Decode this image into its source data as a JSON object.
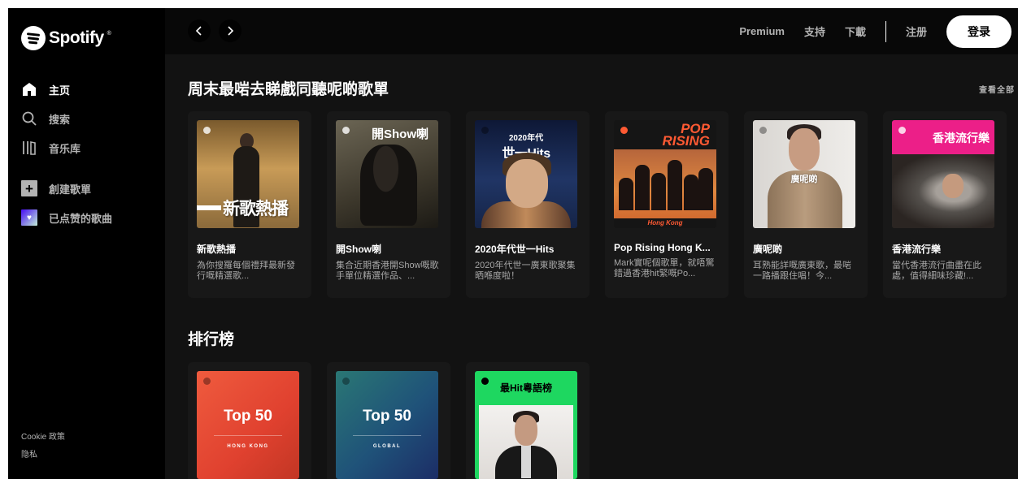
{
  "brand": {
    "name": "Spotify"
  },
  "sidebar": {
    "nav": [
      {
        "label": "主页",
        "icon": "home-icon"
      },
      {
        "label": "搜索",
        "icon": "search-icon"
      },
      {
        "label": "音乐库",
        "icon": "library-icon"
      }
    ],
    "actions": [
      {
        "label": "創建歌單",
        "icon": "plus-icon"
      },
      {
        "label": "已点赞的歌曲",
        "icon": "heart-icon"
      }
    ],
    "legal": {
      "cookie": "Cookie 政策",
      "privacy": "隐私"
    }
  },
  "topbar": {
    "premium": "Premium",
    "support": "支持",
    "download": "下載",
    "signup": "注册",
    "login": "登录"
  },
  "section1": {
    "title": "周末最啱去睇戲同聽呢啲歌單",
    "see_all": "查看全部",
    "cards": [
      {
        "title": "新歌熱播",
        "desc": "為你搜羅每個禮拜最新發行嘅精選歌...",
        "cover_text": "新歌熱播"
      },
      {
        "title": "開Show喇",
        "desc": "集合近期香港開Show嘅歌手單位精選作品、...",
        "cover_text": "開Show喇"
      },
      {
        "title": "2020年代世一Hits",
        "desc": "2020年代世一廣東歌聚集晒喺度啦！",
        "cover_text_1": "2020年代",
        "cover_text_2": "世一Hits"
      },
      {
        "title": "Pop Rising Hong K...",
        "desc": "Mark實呢個歌單，就唔驚錯過香港hit緊嘅Po...",
        "cover_text_1": "POP",
        "cover_text_2": "RISING",
        "cover_text_3": "Hong Kong"
      },
      {
        "title": "廣呢啲",
        "desc": "耳熟能詳嘅廣東歌，最啱一路播跟住唱！今...",
        "cover_text": "廣呢啲"
      },
      {
        "title": "香港流行樂",
        "desc": "當代香港流行曲盡在此處，值得細味珍藏!...",
        "cover_text": "香港流行樂"
      }
    ]
  },
  "section2": {
    "title": "排行榜",
    "cards": [
      {
        "cover_big": "Top 50",
        "cover_small": "HONG KONG"
      },
      {
        "cover_big": "Top 50",
        "cover_small": "GLOBAL"
      },
      {
        "cover_text": "最Hit粵語榜"
      }
    ]
  },
  "colors": {
    "accent": "#1ed760",
    "background": "#121212",
    "sidebar": "#000000",
    "card": "#181818"
  }
}
